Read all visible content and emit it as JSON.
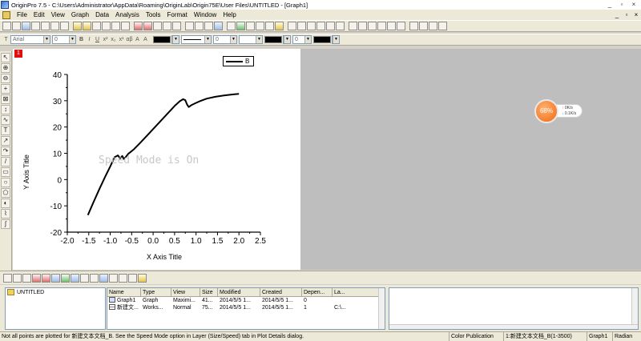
{
  "window": {
    "title": "OriginPro 7.5 - C:\\Users\\Administrator\\AppData\\Roaming\\OriginLab\\Origin75E\\User Files\\UNTITLED - [Graph1]",
    "minimize": "_",
    "restore": "▫",
    "close": "×"
  },
  "menu": [
    "File",
    "Edit",
    "View",
    "Graph",
    "Data",
    "Analysis",
    "Tools",
    "Format",
    "Window",
    "Help"
  ],
  "format_toolbar": {
    "font": "Arial",
    "font_size": "0",
    "bold": "B",
    "italic": "I",
    "underline": "U",
    "line_width_value": "0",
    "pattern_value": "0"
  },
  "graph": {
    "layer_label": "1",
    "legend_label": "B",
    "watermark": "Speed Mode is On",
    "x_axis_title": "X Axis Title",
    "y_axis_title": "Y Axis Title"
  },
  "chart_data": {
    "type": "line",
    "xlim": [
      -2.0,
      2.5
    ],
    "ylim": [
      -20,
      40
    ],
    "x_ticks": [
      "-2.0",
      "-1.5",
      "-1.0",
      "-0.5",
      "0.0",
      "0.5",
      "1.0",
      "1.5",
      "2.0",
      "2.5"
    ],
    "y_ticks": [
      "-20",
      "-10",
      "0",
      "10",
      "20",
      "30",
      "40"
    ],
    "series": [
      {
        "name": "B",
        "color": "#000000",
        "x": [
          -1.52,
          -1.4,
          -1.25,
          -1.12,
          -1.0,
          -0.9,
          -0.82,
          -0.77,
          -0.72,
          -0.68,
          -0.64,
          -0.58,
          -0.45,
          -0.3,
          -0.1,
          0.1,
          0.3,
          0.5,
          0.62,
          0.7,
          0.75,
          0.79,
          0.83,
          0.9,
          1.0,
          1.1,
          1.25,
          1.45,
          1.65,
          1.85,
          2.0
        ],
        "y": [
          -13.5,
          -9.0,
          -3.5,
          1.0,
          5.0,
          8.5,
          9.2,
          8.0,
          9.0,
          7.8,
          8.5,
          9.8,
          11.5,
          14.0,
          17.5,
          21.0,
          24.5,
          28.0,
          29.8,
          30.6,
          30.2,
          28.6,
          27.6,
          28.4,
          29.2,
          29.9,
          30.8,
          31.5,
          32.0,
          32.4,
          32.6
        ]
      }
    ]
  },
  "net_widget": {
    "percent": "68%",
    "up_rate": "0K/s",
    "down_rate": "0.1K/s"
  },
  "explorer": {
    "tree_root": "UNTITLED",
    "columns": [
      "Name",
      "Type",
      "View",
      "Size",
      "Modified",
      "Created",
      "Depen...",
      "La..."
    ],
    "rows": [
      [
        "Graph1",
        "Graph",
        "Maximi...",
        "41...",
        "2014/5/5 1...",
        "2014/5/5 1...",
        "0",
        ""
      ],
      [
        "新建文...",
        "Works...",
        "Normal",
        "75...",
        "2014/5/5 1...",
        "2014/5/5 1...",
        "1",
        "C:\\..."
      ]
    ]
  },
  "status": {
    "message": "Not all points are plotted for 新建文本文档_B. See the Speed Mode option in Layer (Size/Speed) tab in Plot Details dialog.",
    "theme": "Color Publication",
    "dataset": "1:新建文本文档_B(1-3500)",
    "window": "Graph1",
    "angle_unit": "Radian"
  }
}
